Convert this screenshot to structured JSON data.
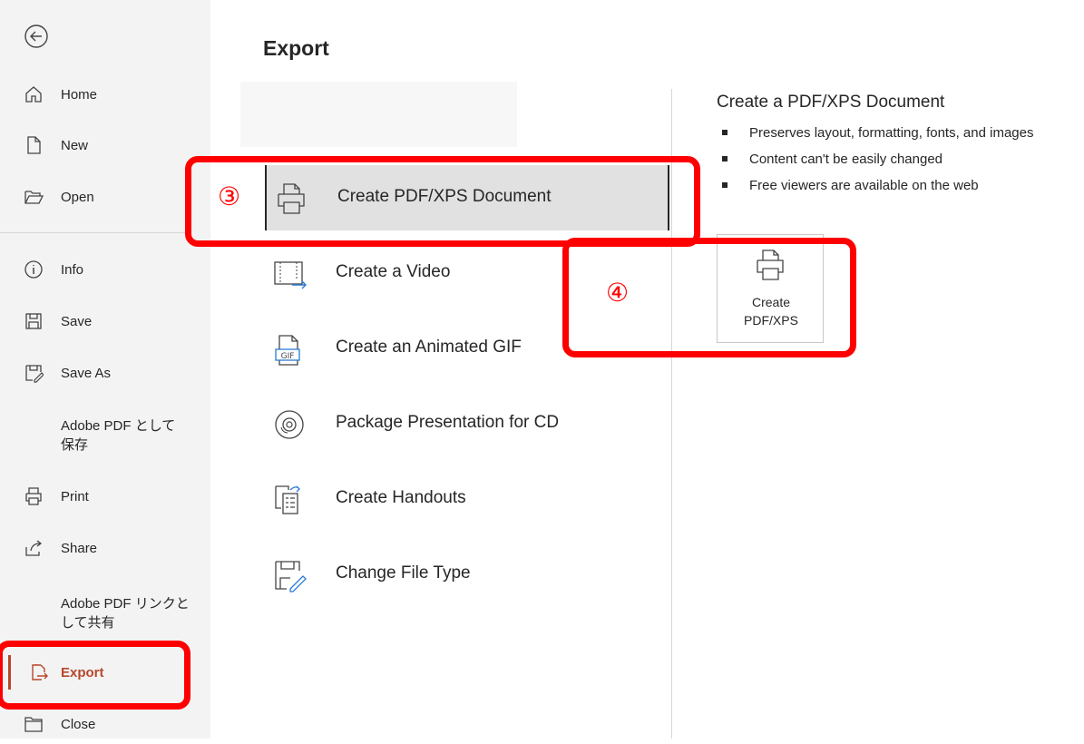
{
  "sidebar": {
    "back_label": "Back",
    "items": [
      {
        "label": "Home",
        "icon": "home-icon"
      },
      {
        "label": "New",
        "icon": "new-doc-icon"
      },
      {
        "label": "Open",
        "icon": "folder-open-icon"
      },
      {
        "label": "Info",
        "icon": "info-icon"
      },
      {
        "label": "Save",
        "icon": "save-icon"
      },
      {
        "label": "Save As",
        "icon": "save-as-icon"
      },
      {
        "label": "Adobe PDF として\n保存",
        "icon": ""
      },
      {
        "label": "Print",
        "icon": "print-icon"
      },
      {
        "label": "Share",
        "icon": "share-icon"
      },
      {
        "label": "Adobe PDF リンクと\nして共有",
        "icon": ""
      },
      {
        "label": "Export",
        "icon": "export-icon",
        "active": true
      },
      {
        "label": "Close",
        "icon": "close-folder-icon"
      }
    ]
  },
  "main": {
    "title": "Export",
    "options": [
      {
        "label": "Create PDF/XPS Document",
        "icon": "pdf-document-icon",
        "selected": true
      },
      {
        "label": "Create a Video",
        "icon": "video-icon"
      },
      {
        "label": "Create an Animated GIF",
        "icon": "gif-icon"
      },
      {
        "label": "Package Presentation for CD",
        "icon": "cd-icon"
      },
      {
        "label": "Create Handouts",
        "icon": "handouts-icon"
      },
      {
        "label": "Change File Type",
        "icon": "change-file-type-icon"
      }
    ]
  },
  "detail": {
    "title": "Create a PDF/XPS Document",
    "bullets": [
      "Preserves layout, formatting, fonts, and images",
      "Content can't be easily changed",
      "Free viewers are available on the web"
    ],
    "button_label": "Create\nPDF/XPS"
  },
  "callouts": {
    "step3": "③",
    "step4": "④",
    "color": "#ff0000"
  },
  "colors": {
    "accent": "#b7472a",
    "sidebar_bg": "#f3f3f3",
    "selected_bg": "#e1e1e1"
  }
}
